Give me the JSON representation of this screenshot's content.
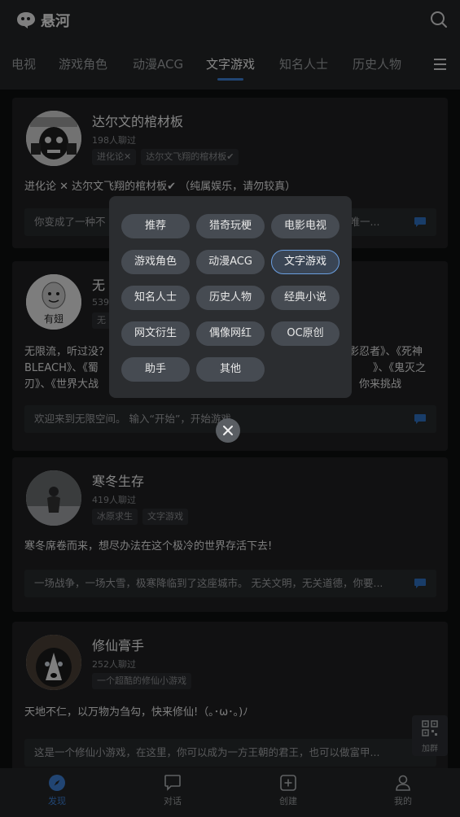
{
  "header": {
    "app_name": "悬河"
  },
  "tabs": [
    "电视",
    "游戏角色",
    "动漫ACG",
    "文字游戏",
    "知名人士",
    "历史人物"
  ],
  "feed": [
    {
      "title": "达尔文的棺材板",
      "count": "198人聊过",
      "tags": [
        "进化论✕",
        "达尔文飞翔的棺材板✔"
      ],
      "desc": "进化论 ✕ 达尔文飞翔的棺材板✔ （纯属娱乐，请勿较真）",
      "preview_left": "你变成了一种不",
      "preview_right": "为唯一..."
    },
    {
      "title_partial": "无",
      "count_partial": "539",
      "tag_partial": "无",
      "desc_l1_left": "无限流，听过没？",
      "desc_l1_right": "影忍者》、《死神",
      "desc_l2_left": "BLEACH》、《蜀",
      "desc_l2_right": "》、《鬼灭之",
      "desc_l3_left": "刃》、《世界大战",
      "desc_l3_right": "你来挑战",
      "preview": "欢迎来到无限空间。 输入“开始”，开始游戏。"
    },
    {
      "title": "寒冬生存",
      "count": "419人聊过",
      "tags": [
        "冰原求生",
        "文字游戏"
      ],
      "desc": "寒冬席卷而来，想尽办法在这个极冷的世界存活下去!",
      "preview": "一场战争，一场大雪，极寒降临到了这座城市。 无关文明，无关道德，你要..."
    },
    {
      "title": "修仙膏手",
      "count": "252人聊过",
      "tags": [
        "一个超酷的修仙小游戏"
      ],
      "desc": "天地不仁，以万物为刍勾，快来修仙!（｡･ω･｡)ﾉ",
      "preview": "这是一个修仙小游戏，在这里，你可以成为一方王朝的君王，也可以做富甲..."
    }
  ],
  "avatar_text": {
    "badge": "有翅"
  },
  "category_modal": {
    "chips": [
      "推荐",
      "猎奇玩梗",
      "电影电视",
      "游戏角色",
      "动漫ACG",
      "文字游戏",
      "知名人士",
      "历史人物",
      "经典小说",
      "网文衍生",
      "偶像网红",
      "OC原创",
      "助手",
      "其他"
    ],
    "selected": "文字游戏"
  },
  "float_button": {
    "label": "加群"
  },
  "bottom_nav": [
    {
      "label": "发现",
      "icon": "compass-icon",
      "active": true
    },
    {
      "label": "对话",
      "icon": "chat-bubble-icon",
      "active": false
    },
    {
      "label": "创建",
      "icon": "plus-square-icon",
      "active": false
    },
    {
      "label": "我的",
      "icon": "user-icon",
      "active": false
    }
  ],
  "colors": {
    "accent": "#3d7fd1",
    "background": "#141516",
    "card": "#1f2022",
    "chip": "#464b52"
  }
}
